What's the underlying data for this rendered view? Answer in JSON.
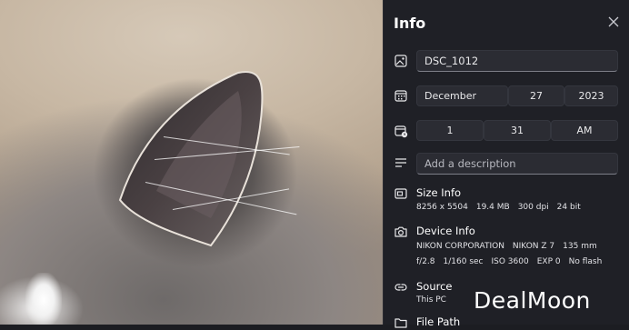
{
  "panel": {
    "title": "Info",
    "name_value": "DSC_1012",
    "date": {
      "month": "December",
      "day": "27",
      "year": "2023"
    },
    "time": {
      "hour": "1",
      "minute": "31",
      "period": "AM"
    },
    "description_placeholder": "Add a description",
    "size_info": {
      "title": "Size Info",
      "dimensions": "8256 x 5504",
      "file_size": "19.4 MB",
      "dpi": "300 dpi",
      "bit_depth": "24 bit"
    },
    "device_info": {
      "title": "Device Info",
      "maker": "NIKON CORPORATION",
      "model": "NIKON Z 7",
      "focal_length": "135 mm",
      "aperture": "f/2.8",
      "shutter": "1/160 sec",
      "iso": "ISO 3600",
      "exposure": "EXP 0",
      "flash": "No flash"
    },
    "source": {
      "title": "Source",
      "value": "This PC"
    },
    "file_path": {
      "title": "File Path"
    }
  },
  "watermark": "DealMoon",
  "icons": [
    "image-icon",
    "calendar-icon",
    "clock-icon",
    "description-icon",
    "size-icon",
    "camera-icon",
    "link-icon",
    "folder-icon",
    "close-icon"
  ],
  "colors": {
    "panel_bg": "#1f2026",
    "field_bg": "#2b2c33",
    "text": "#ffffff"
  }
}
